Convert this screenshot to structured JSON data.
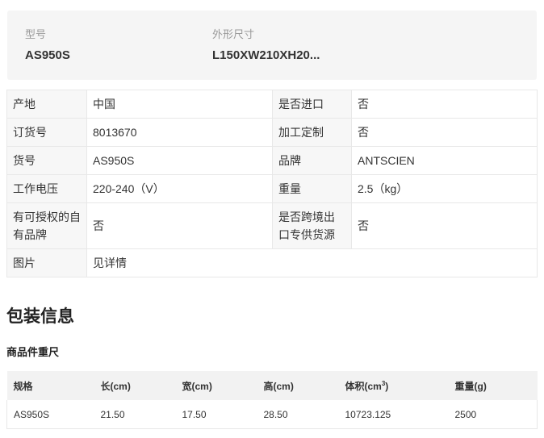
{
  "summary": {
    "model_label": "型号",
    "model_value": "AS950S",
    "size_label": "外形尺寸",
    "size_value": "L150XW210XH20..."
  },
  "specs": {
    "rows": [
      {
        "k1": "产地",
        "v1": "中国",
        "k2": "是否进口",
        "v2": "否"
      },
      {
        "k1": "订货号",
        "v1": "8013670",
        "k2": "加工定制",
        "v2": "否"
      },
      {
        "k1": "货号",
        "v1": "AS950S",
        "k2": "品牌",
        "v2": "ANTSCIEN"
      },
      {
        "k1": "工作电压",
        "v1": "220-240（V）",
        "k2": "重量",
        "v2": "2.5（kg）"
      },
      {
        "k1": "有可授权的自有品牌",
        "v1": "否",
        "k2": "是否跨境出口专供货源",
        "v2": "否"
      },
      {
        "k1": "图片",
        "v1": "见详情"
      }
    ]
  },
  "packaging": {
    "title": "包装信息",
    "subtitle": "商品件重尺",
    "headers": {
      "spec": "规格",
      "length": "长(cm)",
      "width": "宽(cm)",
      "height": "高(cm)",
      "volume": "体积(cm",
      "volume_sup": "3",
      "volume_close": ")",
      "weight": "重量(g)"
    },
    "row": {
      "spec": "AS950S",
      "length": "21.50",
      "width": "17.50",
      "height": "28.50",
      "volume": "10723.125",
      "weight": "2500"
    }
  }
}
